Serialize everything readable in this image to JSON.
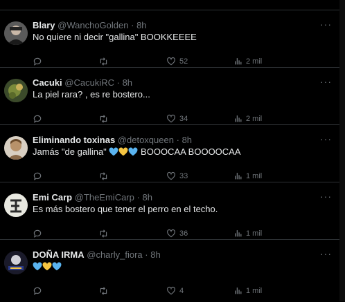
{
  "tweets": [
    {
      "name": "Blary",
      "handle": "@WanchoGolden",
      "sep": "·",
      "time": "8h",
      "text": "No quiere ni decir \"gallina\" BOOKKEEEE",
      "replies": "",
      "retweets": "",
      "likes": "52",
      "views": "2 mil"
    },
    {
      "name": "Cacuki",
      "handle": "@CacukiRC",
      "sep": "·",
      "time": "8h",
      "text": "La piel rara? , es re bostero...",
      "replies": "",
      "retweets": "",
      "likes": "34",
      "views": "2 mil"
    },
    {
      "name": "Eliminando toxinas",
      "handle": "@detoxqueen",
      "sep": "·",
      "time": "8h",
      "text_before": "Jamás \"de gallina\"",
      "text_after": "BOOOCAA BOOOOCAA",
      "emojis": [
        "blue-heart",
        "yellow-heart",
        "blue-heart"
      ],
      "replies": "",
      "retweets": "",
      "likes": "33",
      "views": "1 mil"
    },
    {
      "name": "Emi Carp",
      "handle": "@TheEmiCarp",
      "sep": "·",
      "time": "8h",
      "text": "Es más bostero que tener el perro en el techo.",
      "replies": "",
      "retweets": "",
      "likes": "36",
      "views": "1 mil"
    },
    {
      "name": "DOÑA IRMA",
      "handle": "@charly_fiora",
      "sep": "·",
      "time": "8h",
      "text": "",
      "emojis": [
        "blue-heart",
        "yellow-heart",
        "blue-heart"
      ],
      "replies": "",
      "retweets": "",
      "likes": "4",
      "views": "1 mil"
    }
  ],
  "more_glyph": "···",
  "colors": {
    "background": "#000000",
    "text": "#e7e9ea",
    "secondary": "#71767b",
    "divider": "#2f3336",
    "blue_heart": "#5ab4f0",
    "yellow_heart": "#f5c542"
  },
  "icons": [
    "reply-icon",
    "retweet-icon",
    "like-icon",
    "views-icon",
    "bookmark-icon",
    "share-icon",
    "more-icon"
  ]
}
